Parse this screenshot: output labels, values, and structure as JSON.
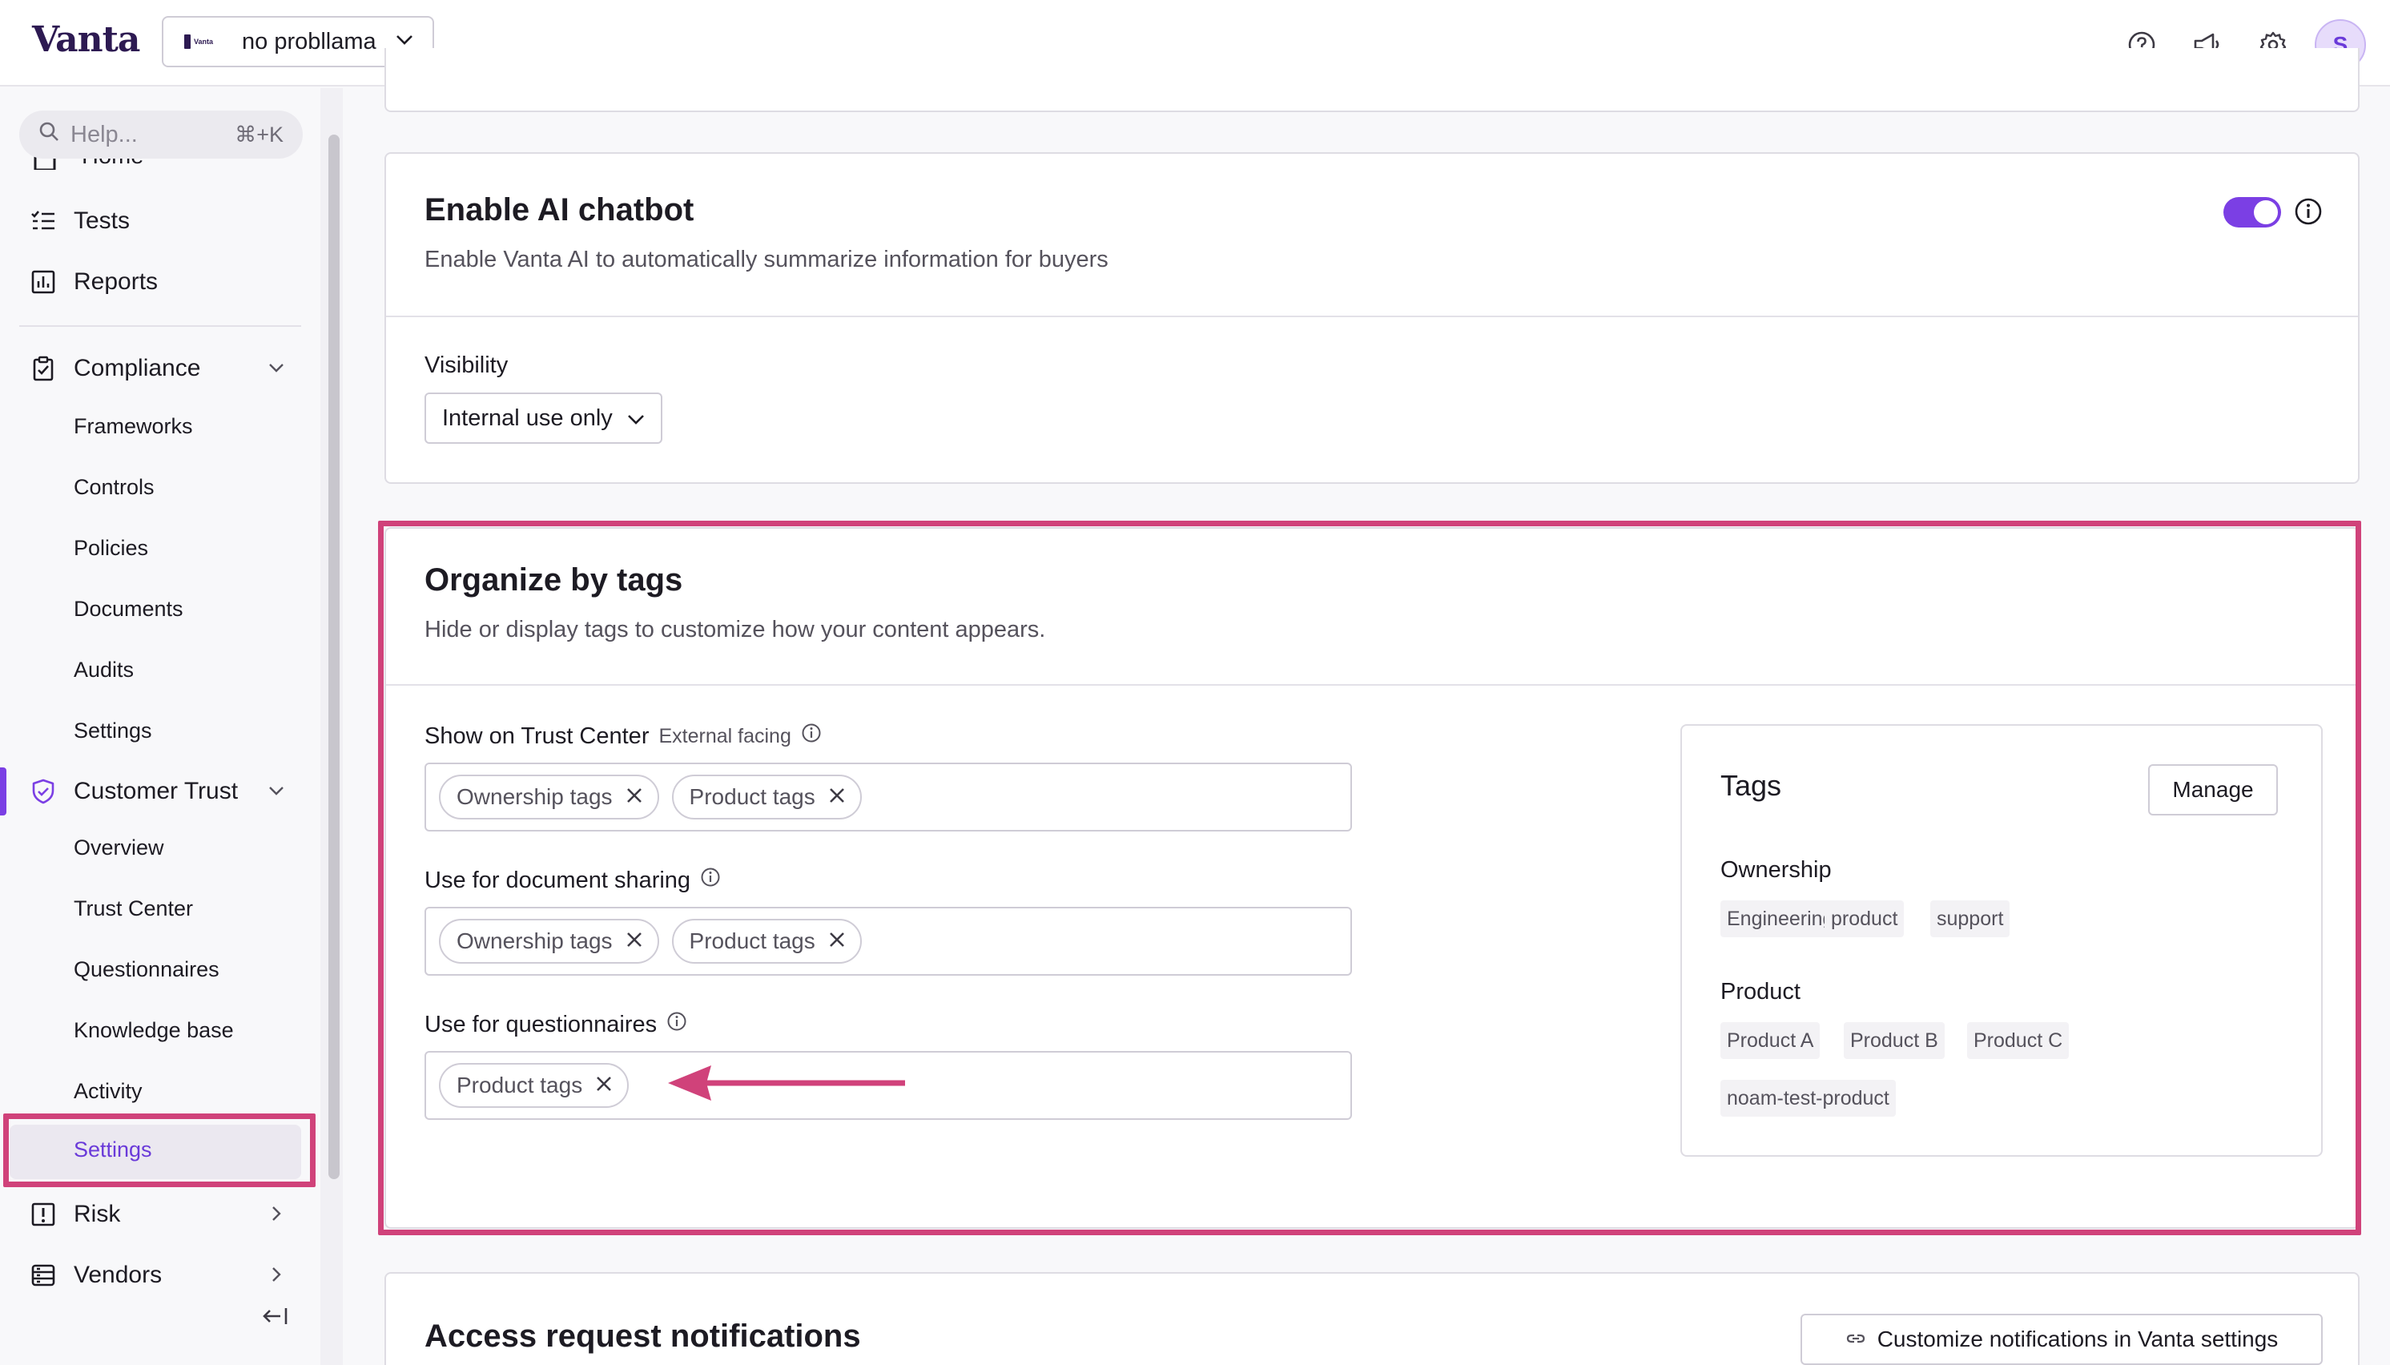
{
  "app": {
    "logo": "Vanta",
    "org": {
      "name": "no probllama",
      "logo_text": "Vanta"
    },
    "avatar_initial": "S"
  },
  "top_icons": [
    "help-circle-icon",
    "megaphone-icon",
    "gear-icon"
  ],
  "sidebar": {
    "help": {
      "placeholder": "Help...",
      "shortcut": "⌘+K"
    },
    "partial_item": "Home",
    "items": [
      {
        "label": "Tests"
      },
      {
        "label": "Reports"
      }
    ],
    "compliance": {
      "label": "Compliance",
      "children": [
        "Frameworks",
        "Controls",
        "Policies",
        "Documents",
        "Audits",
        "Settings"
      ]
    },
    "customer_trust": {
      "label": "Customer Trust",
      "children": [
        "Overview",
        "Trust Center",
        "Questionnaires",
        "Knowledge base",
        "Activity",
        "Settings"
      ]
    },
    "risk": {
      "label": "Risk"
    },
    "vendors": {
      "label": "Vendors"
    }
  },
  "chatbot": {
    "title": "Enable AI chatbot",
    "subtitle": "Enable Vanta AI to automatically summarize information for buyers",
    "toggle_on": true,
    "visibility_label": "Visibility",
    "visibility_value": "Internal use only"
  },
  "tags_section": {
    "title": "Organize by tags",
    "subtitle": "Hide or display tags to customize how your content appears.",
    "fields": [
      {
        "label": "Show on Trust Center",
        "note": "External facing",
        "chips": [
          "Ownership tags",
          "Product tags"
        ]
      },
      {
        "label": "Use for document sharing",
        "note": "",
        "chips": [
          "Ownership tags",
          "Product tags"
        ]
      },
      {
        "label": "Use for questionnaires",
        "note": "",
        "chips": [
          "Product tags"
        ]
      }
    ],
    "panel": {
      "title": "Tags",
      "manage_label": "Manage",
      "groups": [
        {
          "name": "Ownership",
          "tags": [
            "Engineering",
            "product",
            "support"
          ]
        },
        {
          "name": "Product",
          "tags": [
            "Product A",
            "Product B",
            "Product C",
            "noam-test-product"
          ]
        }
      ]
    }
  },
  "access_section": {
    "title": "Access request notifications",
    "button_label": "Customize notifications in Vanta settings"
  },
  "colors": {
    "accent": "#7b3fe4",
    "highlight": "#d0427a"
  }
}
